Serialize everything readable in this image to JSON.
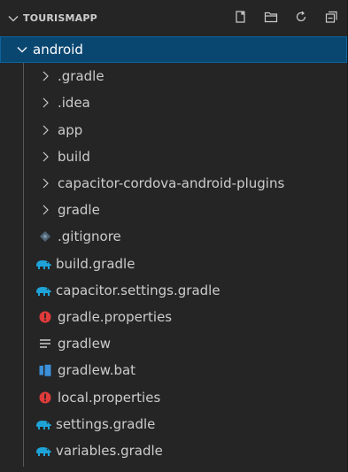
{
  "explorer": {
    "title": "TOURISMAPP",
    "actions": [
      {
        "name": "new-file-icon"
      },
      {
        "name": "new-folder-icon"
      },
      {
        "name": "refresh-icon"
      },
      {
        "name": "collapse-all-icon"
      }
    ]
  },
  "tree": {
    "root": {
      "label": "android",
      "expanded": true,
      "selected": true
    },
    "folders": [
      {
        "label": ".gradle"
      },
      {
        "label": ".idea"
      },
      {
        "label": "app"
      },
      {
        "label": "build"
      },
      {
        "label": "capacitor-cordova-android-plugins"
      },
      {
        "label": "gradle"
      }
    ],
    "files": [
      {
        "label": ".gitignore",
        "icon": "git-icon"
      },
      {
        "label": "build.gradle",
        "icon": "gradle-elephant-icon"
      },
      {
        "label": "capacitor.settings.gradle",
        "icon": "gradle-elephant-icon"
      },
      {
        "label": "gradle.properties",
        "icon": "properties-icon"
      },
      {
        "label": "gradlew",
        "icon": "lines-icon"
      },
      {
        "label": "gradlew.bat",
        "icon": "windows-icon"
      },
      {
        "label": "local.properties",
        "icon": "properties-icon"
      },
      {
        "label": "settings.gradle",
        "icon": "gradle-elephant-icon"
      },
      {
        "label": "variables.gradle",
        "icon": "gradle-elephant-icon"
      }
    ]
  },
  "colors": {
    "background": "#252526",
    "selection": "#094771",
    "selection_border": "#0e639c",
    "text": "#cccccc",
    "gradle_icon": "#1ea3d8",
    "properties_icon": "#e03a3a",
    "windows_icon": "#3c8fd9",
    "git_icon": "#5a6e7e"
  }
}
